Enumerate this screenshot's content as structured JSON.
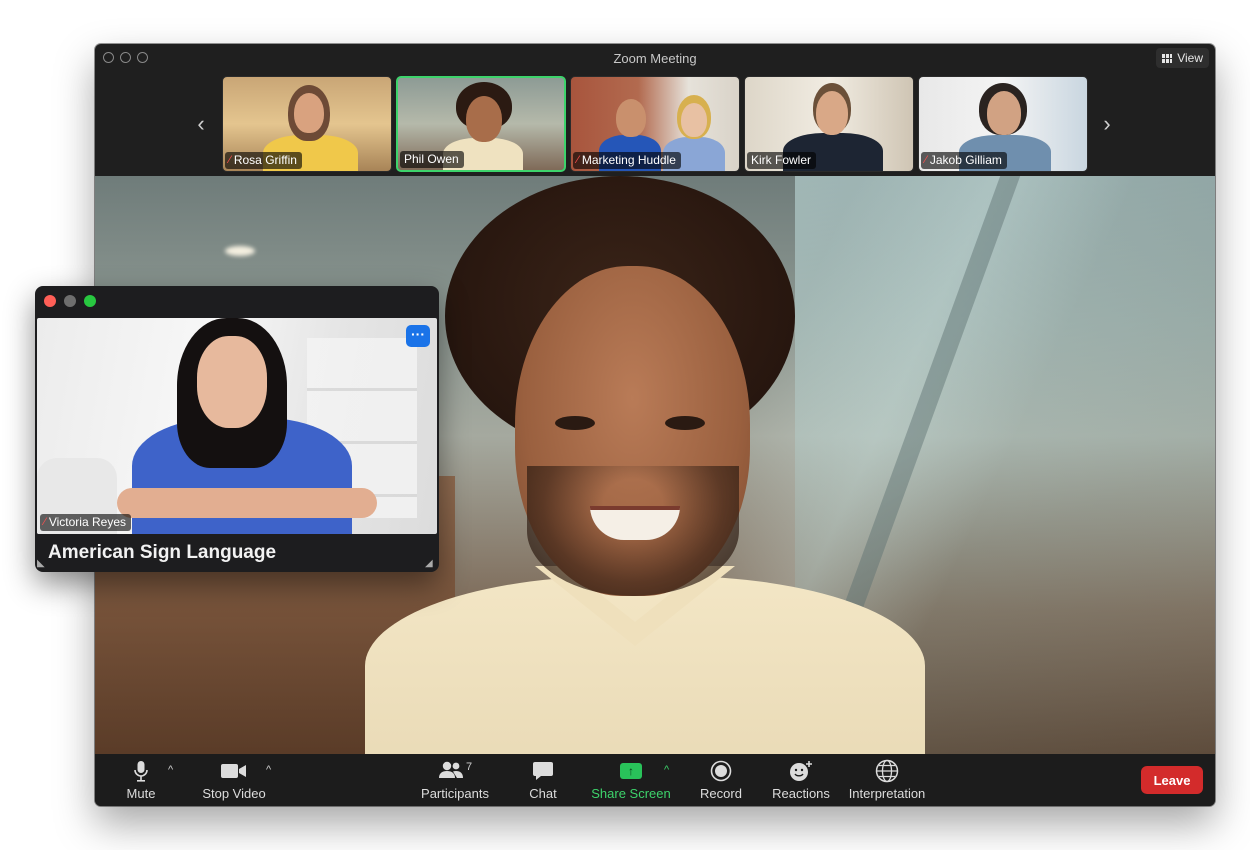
{
  "window": {
    "title": "Zoom Meeting",
    "view_label": "View"
  },
  "filmstrip": {
    "prev_icon": "chevron-left-icon",
    "next_icon": "chevron-right-icon",
    "tiles": [
      {
        "name": "Rosa Griffin",
        "muted": true,
        "active": false
      },
      {
        "name": "Phil Owen",
        "muted": false,
        "active": true
      },
      {
        "name": "Marketing Huddle",
        "muted": true,
        "active": false
      },
      {
        "name": "Kirk Fowler",
        "muted": false,
        "active": false
      },
      {
        "name": "Jakob Gilliam",
        "muted": true,
        "active": false
      }
    ]
  },
  "interpreter": {
    "name": "Victoria Reyes",
    "muted": true,
    "language": "American Sign Language",
    "more_icon": "more-icon"
  },
  "toolbar": {
    "mute": "Mute",
    "stop_video": "Stop Video",
    "participants": "Participants",
    "participants_count": "7",
    "chat": "Chat",
    "share_screen": "Share Screen",
    "record": "Record",
    "reactions": "Reactions",
    "interpretation": "Interpretation",
    "leave": "Leave"
  },
  "colors": {
    "active_speaker": "#3dd36b",
    "share_green": "#29c25a",
    "leave_red": "#d32b2b",
    "more_blue": "#1a73e8",
    "muted_red": "#ff5050"
  }
}
